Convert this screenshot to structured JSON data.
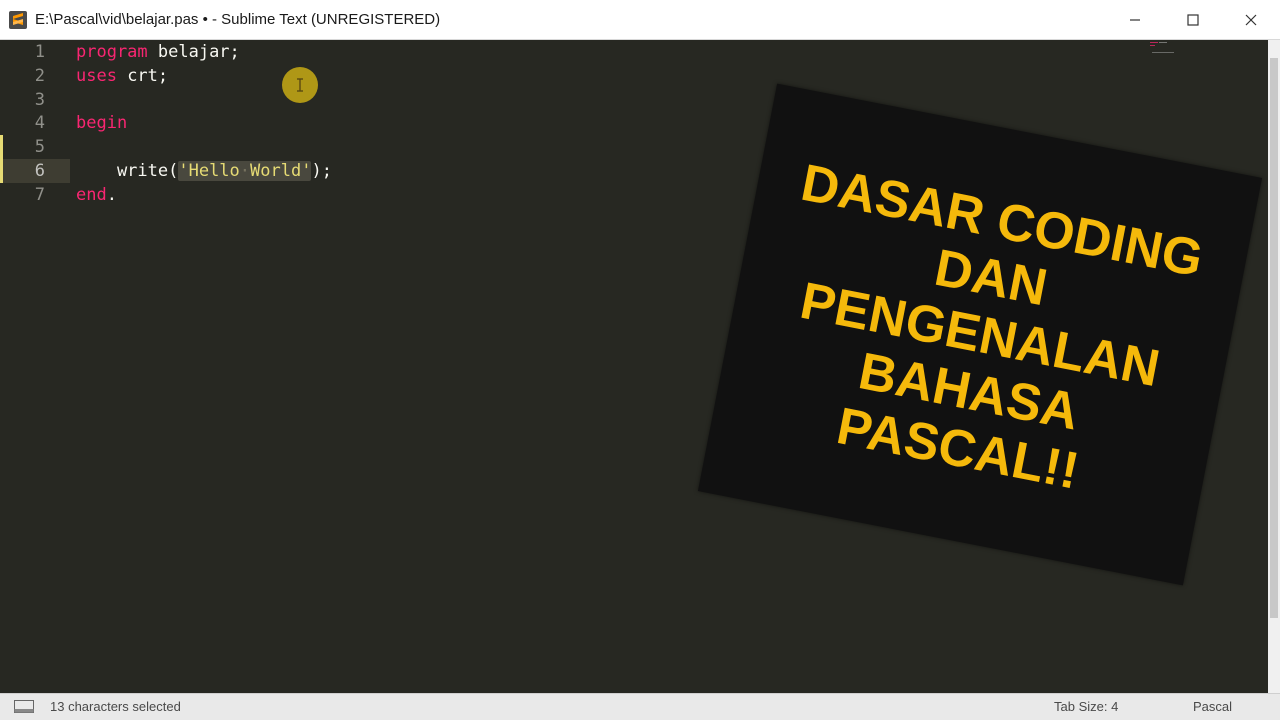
{
  "window": {
    "title": "E:\\Pascal\\vid\\belajar.pas • - Sublime Text (UNREGISTERED)"
  },
  "editor": {
    "line_numbers": [
      "1",
      "2",
      "3",
      "4",
      "5",
      "6",
      "7"
    ],
    "lines": {
      "l1": {
        "kw": "program",
        "rest": " belajar;"
      },
      "l2": {
        "kw": "uses",
        "rest": " crt;"
      },
      "l4": {
        "kw": "begin"
      },
      "l6": {
        "indent": "    write(",
        "str_open": "'Hello",
        "str_sep": "·",
        "str_close": "World'",
        "rest": ");"
      },
      "l7": {
        "kw": "end",
        "rest": "."
      }
    },
    "active_line": "6"
  },
  "overlay": {
    "lines": [
      "DASAR CODING",
      "DAN",
      "PENGENALAN",
      "BAHASA",
      "PASCAL!!"
    ],
    "text_color": "#f5b90b",
    "background_color": "#111111"
  },
  "statusbar": {
    "selection": "13 characters selected",
    "tab_size": "Tab Size: 4",
    "syntax": "Pascal"
  },
  "icons": {
    "app": "sublime-text-icon",
    "minimize": "minimize-icon",
    "maximize": "maximize-icon",
    "close": "close-icon",
    "cursor": "text-cursor-icon",
    "panel": "panel-toggle-icon"
  },
  "colors": {
    "editor_bg": "#272822",
    "keyword": "#f92672",
    "string": "#e6db74",
    "text": "#f8f8f2",
    "gutter_text": "#90908a"
  }
}
